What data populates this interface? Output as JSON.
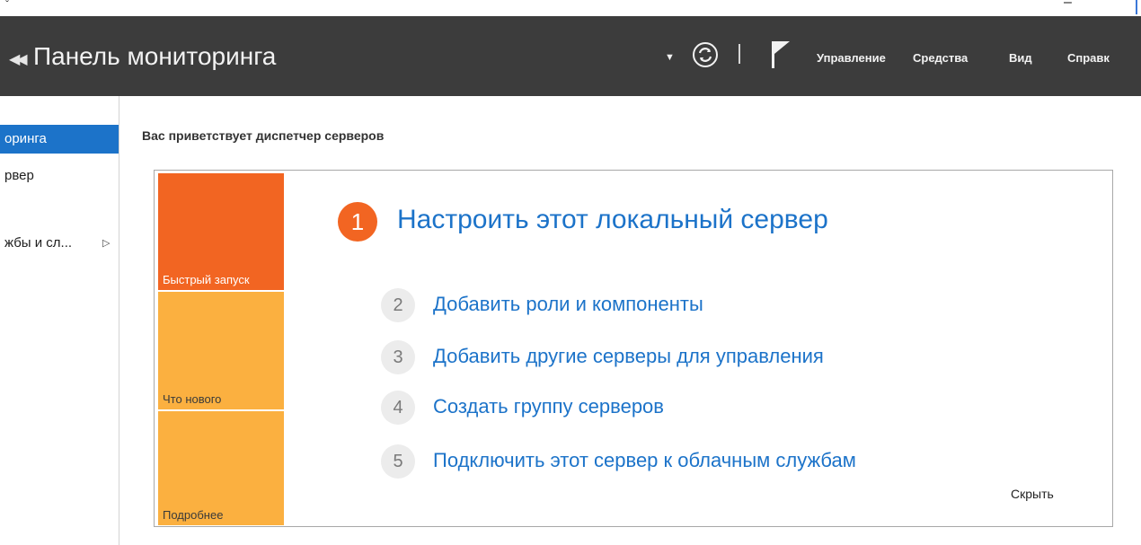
{
  "window": {
    "title": "Панель мониторинга",
    "menu": [
      "Управление",
      "Средства",
      "Вид",
      "Справк"
    ]
  },
  "sidebar": {
    "items": [
      {
        "label": "оринга",
        "active": true
      },
      {
        "label": "рвер",
        "active": false
      },
      {
        "label": "жбы и сл...",
        "active": false
      }
    ]
  },
  "main": {
    "welcome": "Вас приветствует диспетчер серверов",
    "tiles": [
      "Быстрый запуск",
      "Что нового",
      "Подробнее"
    ],
    "step1": {
      "number": "1",
      "label": "Настроить этот локальный сервер"
    },
    "steps": [
      {
        "number": "2",
        "label": "Добавить роли и компоненты"
      },
      {
        "number": "3",
        "label": "Добавить другие серверы для управления"
      },
      {
        "number": "4",
        "label": "Создать группу серверов"
      },
      {
        "number": "5",
        "label": "Подключить этот сервер к облачным службам"
      }
    ],
    "hide": "Скрыть"
  },
  "icons": {
    "back": "back-arrows-icon",
    "dropdown": "dropdown-arrow-icon",
    "refresh": "refresh-icon",
    "flag": "flag-icon",
    "submenu": "submenu-arrow-icon"
  },
  "colors": {
    "titlebar": "#3c3c3c",
    "accent": "#1c73c9",
    "quickstart_tile": "#f26522",
    "info_tile": "#fbb040"
  }
}
